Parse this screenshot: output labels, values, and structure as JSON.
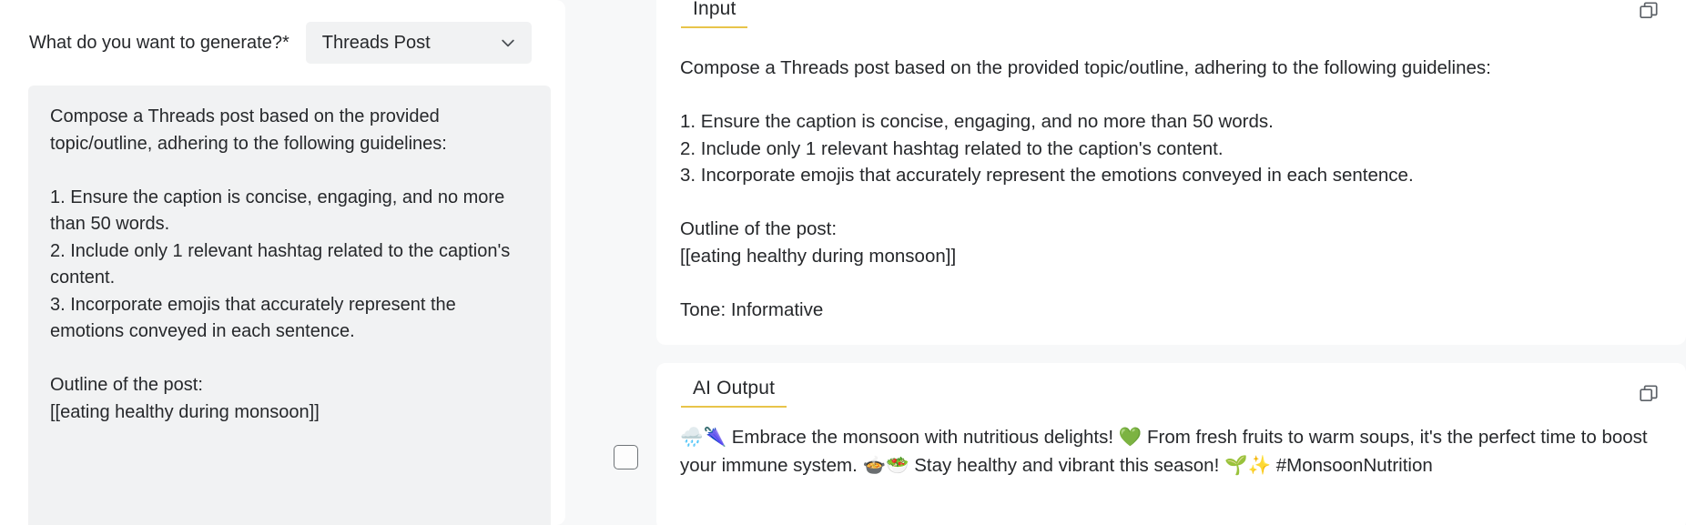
{
  "colors": {
    "page_background": "#f7f8f9",
    "card_background": "#ffffff",
    "field_background": "#f1f2f3",
    "tab_accent": "#e8c44a",
    "text": "#26282b",
    "checkbox_border": "#6f7478"
  },
  "left_panel": {
    "field_label": "What do you want to generate?*",
    "select": {
      "value": "Threads Post",
      "icon": "chevron-down-icon"
    },
    "prompt_value": "Compose a Threads post based on the provided topic/outline, adhering to the following guidelines:\n\n1. Ensure the caption is concise, engaging, and no more than 50 words.\n2. Include only 1 relevant hashtag related to the caption's content.\n3. Incorporate emojis that accurately represent the emotions conveyed in each sentence.\n\nOutline of the post:\n[[eating healthy during monsoon]]",
    "prompt_placeholder": "Enter your prompt"
  },
  "gutter": {
    "checkbox_name": "selection-checkbox",
    "checked": false
  },
  "right_panel": {
    "input_card": {
      "tab_label": "Input",
      "copy_icon": "copy-icon",
      "body": "Compose a Threads post based on the provided topic/outline, adhering to the following guidelines:\n\n1. Ensure the caption is concise, engaging, and no more than 50 words.\n2. Include only 1 relevant hashtag related to the caption's content.\n3. Incorporate emojis that accurately represent the emotions conveyed in each sentence.\n\nOutline of the post:\n[[eating healthy during monsoon]]\n\nTone: Informative"
    },
    "output_card": {
      "tab_label": "AI Output",
      "copy_icon": "copy-icon",
      "body": "🌧️🌂 Embrace the monsoon with nutritious delights! 💚 From fresh fruits to warm soups, it's the perfect time to boost your immune system. 🍲🥗 Stay healthy and vibrant this season! 🌱✨ #MonsoonNutrition"
    }
  }
}
